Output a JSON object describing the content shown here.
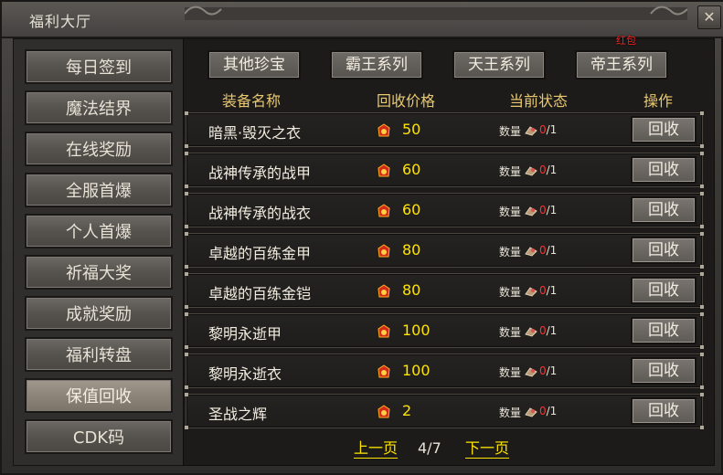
{
  "window": {
    "title": "福利大厅",
    "close_label": "✕"
  },
  "sidebar": {
    "items": [
      {
        "label": "每日签到",
        "active": false
      },
      {
        "label": "魔法结界",
        "active": false
      },
      {
        "label": "在线奖励",
        "active": false
      },
      {
        "label": "全服首爆",
        "active": false
      },
      {
        "label": "个人首爆",
        "active": false
      },
      {
        "label": "祈福大奖",
        "active": false
      },
      {
        "label": "成就奖励",
        "active": false
      },
      {
        "label": "福利转盘",
        "active": false
      },
      {
        "label": "保值回收",
        "active": true
      },
      {
        "label": "CDK码",
        "active": false
      }
    ]
  },
  "tabs": [
    {
      "label": "其他珍宝"
    },
    {
      "label": "霸王系列"
    },
    {
      "label": "天王系列"
    },
    {
      "label": "帝王系列"
    }
  ],
  "badge": {
    "label": "红包"
  },
  "table": {
    "headers": [
      "装备名称",
      "回收价格",
      "当前状态",
      "操作"
    ],
    "qty_label": "数量",
    "button_label": "回收",
    "rows": [
      {
        "name": "暗黑·毁灭之衣",
        "price": "50",
        "have": "0",
        "need": "/1"
      },
      {
        "name": "战神传承的战甲",
        "price": "60",
        "have": "0",
        "need": "/1"
      },
      {
        "name": "战神传承的战衣",
        "price": "60",
        "have": "0",
        "need": "/1"
      },
      {
        "name": "卓越的百练金甲",
        "price": "80",
        "have": "0",
        "need": "/1"
      },
      {
        "name": "卓越的百练金铠",
        "price": "80",
        "have": "0",
        "need": "/1"
      },
      {
        "name": "黎明永逝甲",
        "price": "100",
        "have": "0",
        "need": "/1"
      },
      {
        "name": "黎明永逝衣",
        "price": "100",
        "have": "0",
        "need": "/1"
      },
      {
        "name": "圣战之辉",
        "price": "2",
        "have": "0",
        "need": "/1"
      }
    ]
  },
  "pager": {
    "prev_label": "上一页",
    "page": "4/7",
    "next_label": "下一页"
  },
  "colors": {
    "accent_yellow": "#ffe400",
    "header_gold": "#e8c870",
    "alert_red": "#ff3030"
  },
  "icons": {
    "price_icon": "red-envelope-coin-icon",
    "qty_icon": "gem-icon"
  }
}
